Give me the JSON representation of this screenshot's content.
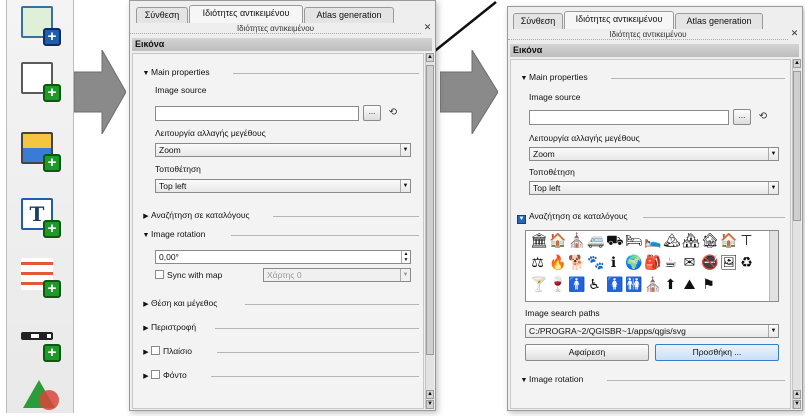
{
  "tabs": {
    "composition": "Σύνθεση",
    "item_properties": "Ιδιότητες αντικειμένου",
    "atlas": "Atlas generation"
  },
  "dock_subtitle": "Ιδιότητες αντικειμένου",
  "close_glyph": "✕",
  "section_title": "Εικόνα",
  "groups": {
    "main_properties": "Main properties",
    "search_directories": "Αναζήτηση σε καταλόγους",
    "image_rotation": "Image rotation",
    "position_size": "Θέση και μέγεθος",
    "rotation": "Περιστροφή",
    "frame": "Πλαίσιο",
    "background": "Φόντο"
  },
  "fields": {
    "image_source_label": "Image source",
    "image_source_value": "",
    "browse_label": "...",
    "resize_mode_label": "Λειτουργία αλλαγής μεγέθους",
    "resize_mode_value": "Zoom",
    "placement_label": "Τοποθέτηση",
    "placement_value": "Top left",
    "rotation_value": "0,00°",
    "sync_with_map_label": "Sync with map",
    "map_value": "Χάρτης 0",
    "search_paths_label": "Image search paths",
    "search_path_value": "C:/PROGRA~2/QGISBR~1/apps/qgis/svg",
    "remove_button": "Αφαίρεση",
    "add_button": "Προσθήκη ..."
  },
  "glyphs": {
    "triangle_down": "▼",
    "triangle_right": "▶",
    "dropdown": "▼",
    "spin_up": "▲",
    "spin_down": "▼",
    "plus": "+",
    "refresh": "⟲",
    "check": "✓"
  },
  "svg_icons": [
    "🏛",
    "🏠",
    "⛪",
    "🚐",
    "⛟",
    "🛏",
    "🛌",
    "🏔",
    "🏘",
    "🏚",
    "🏠",
    "⊤",
    "⚖",
    "🔥",
    "🐕",
    "🐾",
    "ℹ",
    "🌍",
    "🎒",
    "☕",
    "✉",
    "🚭",
    "🖼",
    "♻",
    "🍸",
    "🍷",
    "🚹",
    "♿",
    "🚺",
    "🚻",
    "⛪",
    "⬆",
    "⛰",
    "⚑"
  ],
  "colors": {
    "plus_green": "#1f9a2a",
    "plus_blue": "#1d5fae",
    "arrow_gray": "#8a8a8a"
  }
}
